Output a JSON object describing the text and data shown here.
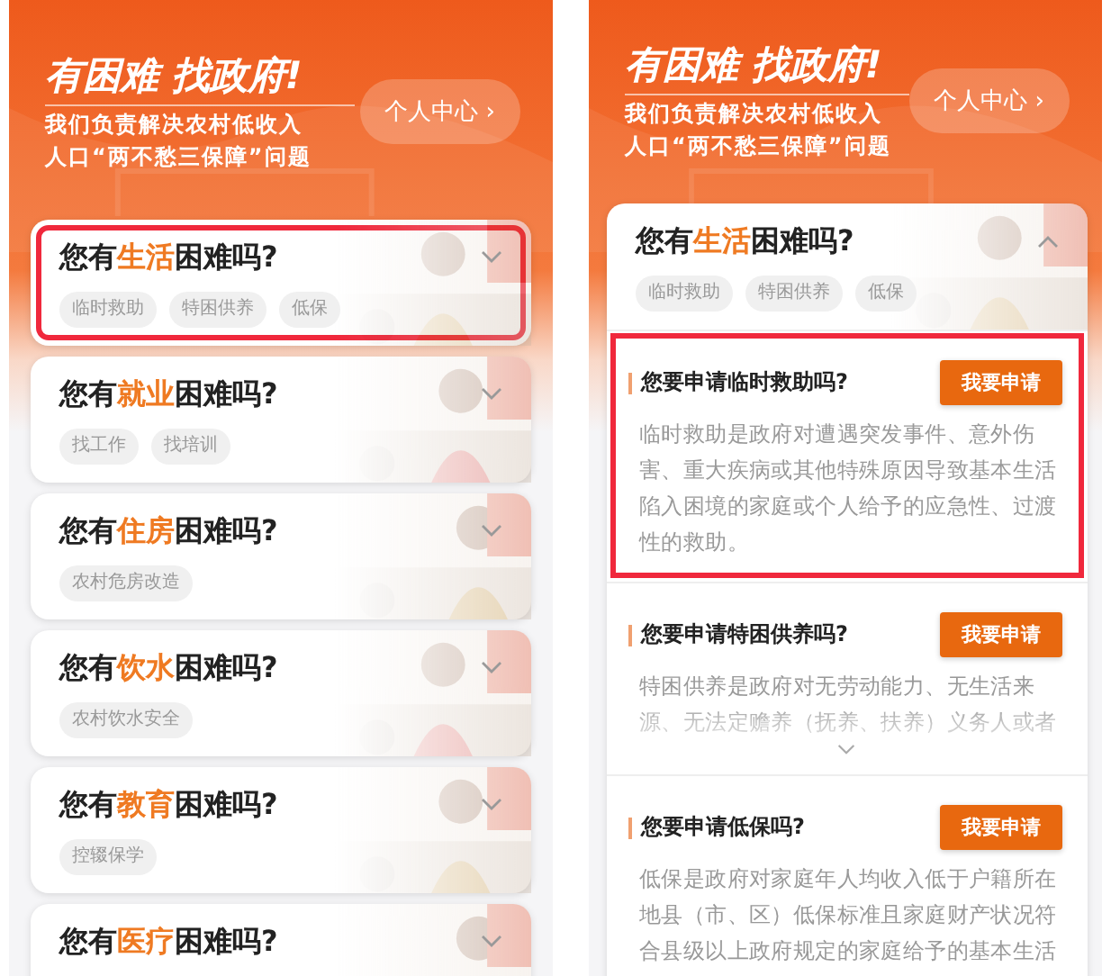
{
  "panels": [
    {
      "header": {
        "title": "有困难 找政府!",
        "subtitle_lines": [
          "我们负责解决农村低收入",
          "人口“两不愁三保障”问题"
        ],
        "profile_button": "个人中心",
        "profile_chevron": "›"
      },
      "categories": [
        {
          "prefix": "您有",
          "keyword": "生活",
          "suffix": "困难吗?",
          "tags": [
            "临时救助",
            "特困供养",
            "低保"
          ],
          "expanded": false,
          "highlighted": true
        },
        {
          "prefix": "您有",
          "keyword": "就业",
          "suffix": "困难吗?",
          "tags": [
            "找工作",
            "找培训"
          ],
          "expanded": false,
          "highlighted": false
        },
        {
          "prefix": "您有",
          "keyword": "住房",
          "suffix": "困难吗?",
          "tags": [
            "农村危房改造"
          ],
          "expanded": false,
          "highlighted": false
        },
        {
          "prefix": "您有",
          "keyword": "饮水",
          "suffix": "困难吗?",
          "tags": [
            "农村饮水安全"
          ],
          "expanded": false,
          "highlighted": false
        },
        {
          "prefix": "您有",
          "keyword": "教育",
          "suffix": "困难吗?",
          "tags": [
            "控辍保学"
          ],
          "expanded": false,
          "highlighted": false
        },
        {
          "prefix": "您有",
          "keyword": "医疗",
          "suffix": "困难吗?",
          "expanded": false,
          "highlighted": false
        }
      ]
    },
    {
      "header": {
        "title": "有困难 找政府!",
        "subtitle_lines": [
          "我们负责解决农村低收入",
          "人口“两不愁三保障”问题"
        ],
        "profile_button": "个人中心",
        "profile_chevron": "›"
      },
      "categories": [
        {
          "prefix": "您有",
          "keyword": "生活",
          "suffix": "困难吗?",
          "tags": [
            "临时救助",
            "特困供养",
            "低保"
          ],
          "expanded": true,
          "highlighted": false,
          "items": [
            {
              "question": "您要申请临时救助吗?",
              "button": "我要申请",
              "description": "临时救助是政府对遭遇突发事件、意外伤害、重大疾病或其他特殊原因导致基本生活陷入困境的家庭或个人给予的应急性、过渡性的救助。",
              "collapsed": false,
              "highlighted": true
            },
            {
              "question": "您要申请特困供养吗?",
              "button": "我要申请",
              "description": "特困供养是政府对无劳动能力、无生活来源、无法定赡养（抚养、扶养）义务人或者",
              "collapsed": true,
              "highlighted": false
            },
            {
              "question": "您要申请低保吗?",
              "button": "我要申请",
              "description": "低保是政府对家庭年人均收入低于户籍所在地县（市、区）低保标准且家庭财产状况符合县级以上政府规定的家庭给予的基本生活",
              "collapsed": false,
              "highlighted": false
            }
          ]
        }
      ]
    }
  ]
}
